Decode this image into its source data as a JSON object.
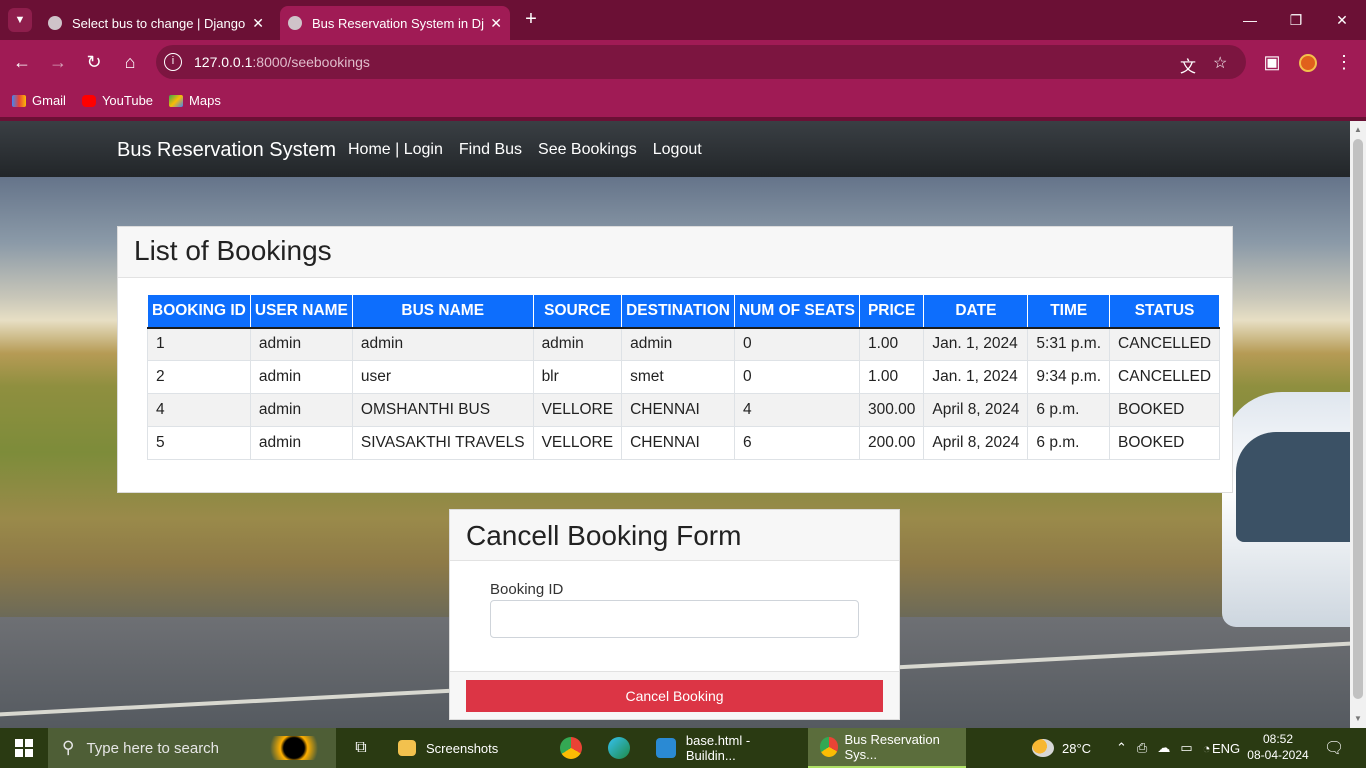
{
  "browser": {
    "tabs": [
      {
        "title": "Select bus to change | Django s",
        "active": false
      },
      {
        "title": "Bus Reservation System in Djan",
        "active": true
      }
    ],
    "url_host": "127.0.0.1",
    "url_path": ":8000/seebookings",
    "bookmarks": [
      "Gmail",
      "YouTube",
      "Maps"
    ]
  },
  "site": {
    "brand": "Bus Reservation System",
    "nav": [
      "Home | Login",
      "Find Bus",
      "See Bookings",
      "Logout"
    ]
  },
  "bookings": {
    "title": "List of Bookings",
    "columns": [
      "BOOKING ID",
      "USER NAME",
      "BUS NAME",
      "SOURCE",
      "DESTINATION",
      "NUM OF SEATS",
      "PRICE",
      "DATE",
      "TIME",
      "STATUS"
    ],
    "rows": [
      [
        "1",
        "admin",
        "admin",
        "admin",
        "admin",
        "0",
        "1.00",
        "Jan. 1, 2024",
        "5:31 p.m.",
        "CANCELLED"
      ],
      [
        "2",
        "admin",
        "user",
        "blr",
        "smet",
        "0",
        "1.00",
        "Jan. 1, 2024",
        "9:34 p.m.",
        "CANCELLED"
      ],
      [
        "4",
        "admin",
        "OMSHANTHI BUS",
        "VELLORE",
        "CHENNAI",
        "4",
        "300.00",
        "April 8, 2024",
        "6 p.m.",
        "BOOKED"
      ],
      [
        "5",
        "admin",
        "SIVASAKTHI TRAVELS",
        "VELLORE",
        "CHENNAI",
        "6",
        "200.00",
        "April 8, 2024",
        "6 p.m.",
        "BOOKED"
      ]
    ]
  },
  "cancel_form": {
    "title": "Cancell Booking Form",
    "field_label": "Booking ID",
    "field_value": "",
    "button": "Cancel Booking"
  },
  "taskbar": {
    "search_placeholder": "Type here to search",
    "items": [
      "Screenshots",
      "base.html - Buildin...",
      "Bus Reservation Sys..."
    ],
    "weather": "28°C",
    "lang": "ENG",
    "time": "08:52",
    "date": "08-04-2024"
  },
  "colors": {
    "browser_frame": "#6b1035",
    "browser_toolbar": "#a01b55",
    "table_header": "#0d6efd",
    "cancel_button": "#dc3545",
    "taskbar": "#2a3a12"
  }
}
